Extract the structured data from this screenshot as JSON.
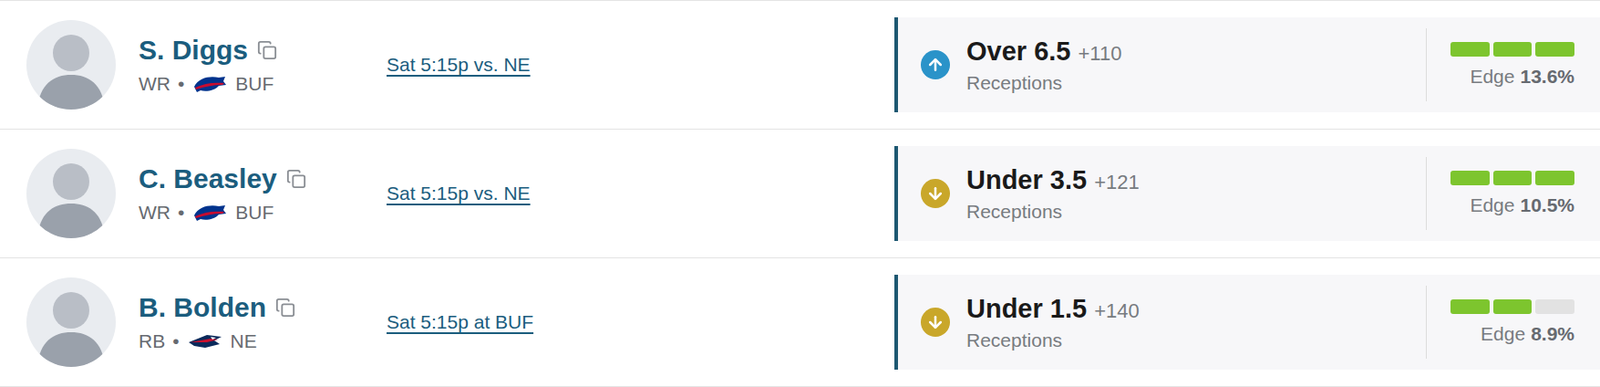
{
  "rows": [
    {
      "player": {
        "name": "S. Diggs",
        "position": "WR",
        "bullet": "•",
        "team": "BUF"
      },
      "game": "Sat 5:15p vs. NE",
      "pick": {
        "kind": "over",
        "label": "Over 6.5",
        "odds": "+110",
        "stat": "Receptions",
        "color": "#2a93c9"
      },
      "edge": {
        "label": "Edge",
        "value": "13.6%",
        "level": 1
      }
    },
    {
      "player": {
        "name": "C. Beasley",
        "position": "WR",
        "bullet": "•",
        "team": "BUF"
      },
      "game": "Sat 5:15p vs. NE",
      "pick": {
        "kind": "under",
        "label": "Under 3.5",
        "odds": "+121",
        "stat": "Receptions",
        "color": "#c9a72a"
      },
      "edge": {
        "label": "Edge",
        "value": "10.5%",
        "level": 1
      }
    },
    {
      "player": {
        "name": "B. Bolden",
        "position": "RB",
        "bullet": "•",
        "team": "NE"
      },
      "game": "Sat 5:15p at BUF",
      "pick": {
        "kind": "under",
        "label": "Under 1.5",
        "odds": "+140",
        "stat": "Receptions",
        "color": "#c9a72a"
      },
      "edge": {
        "label": "Edge",
        "value": "8.9%",
        "level": 0.67
      }
    }
  ]
}
